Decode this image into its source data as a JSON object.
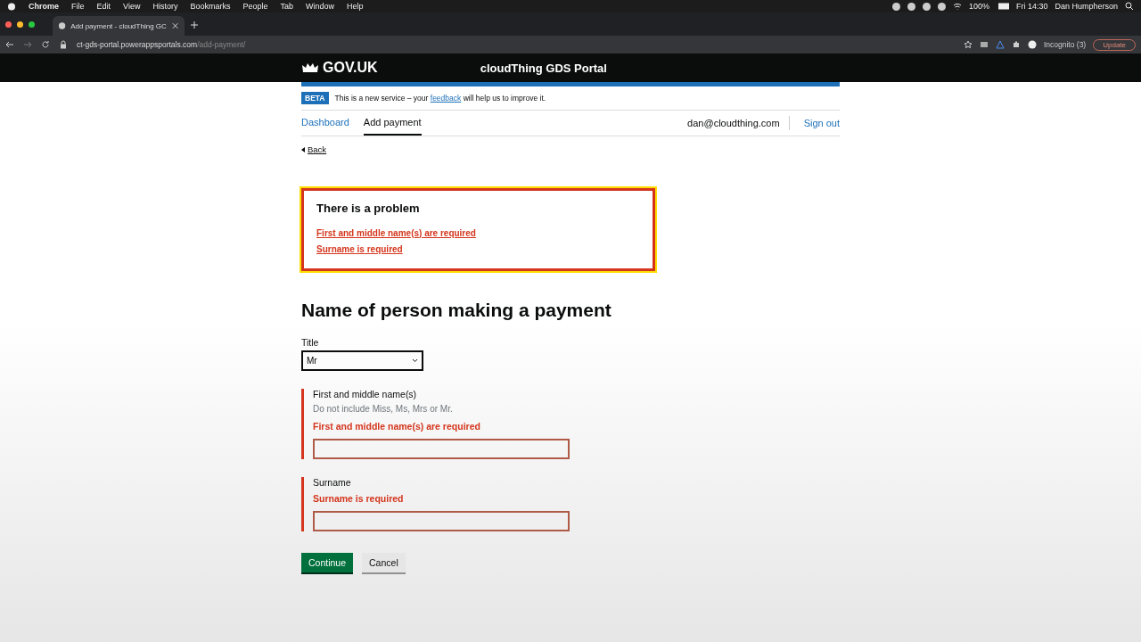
{
  "menu_bar": {
    "app": "Chrome",
    "items": [
      "File",
      "Edit",
      "View",
      "History",
      "Bookmarks",
      "People",
      "Tab",
      "Window",
      "Help"
    ],
    "battery": "100%",
    "clock": "Fri 14:30",
    "user": "Dan Humpherson"
  },
  "browser": {
    "tab_title": "Add payment  - cloudThing GC",
    "url_host": "ct-gds-portal.powerappsportals.com",
    "url_path": "/add-payment/",
    "profile": "Incognito (3)",
    "update": "Update"
  },
  "header": {
    "logo": "GOV.UK",
    "service": "cloudThing GDS Portal"
  },
  "phase_banner": {
    "tag": "BETA",
    "before": "This is a new service – your",
    "link": "feedback",
    "after": "will help us to improve it."
  },
  "nav": {
    "items": [
      {
        "label": "Dashboard",
        "selected": false
      },
      {
        "label": "Add payment",
        "selected": true
      }
    ],
    "user": "dan@cloudthing.com",
    "sign_out": "Sign out"
  },
  "back": "Back",
  "error_summary": {
    "title": "There is a problem",
    "items": [
      "First and middle name(s) are required",
      "Surname is required"
    ]
  },
  "heading": "Name of person making a payment",
  "fields": [
    {
      "kind": "select",
      "label": "Title",
      "value": "Mr"
    },
    {
      "kind": "text",
      "label": "First and middle name(s)",
      "hint": "Do not include Miss, Ms, Mrs or Mr.",
      "error": "First and middle name(s) are required"
    },
    {
      "kind": "text",
      "label": "Surname",
      "error": "Surname is required"
    }
  ],
  "buttons": {
    "continue": "Continue",
    "cancel": "Cancel"
  }
}
